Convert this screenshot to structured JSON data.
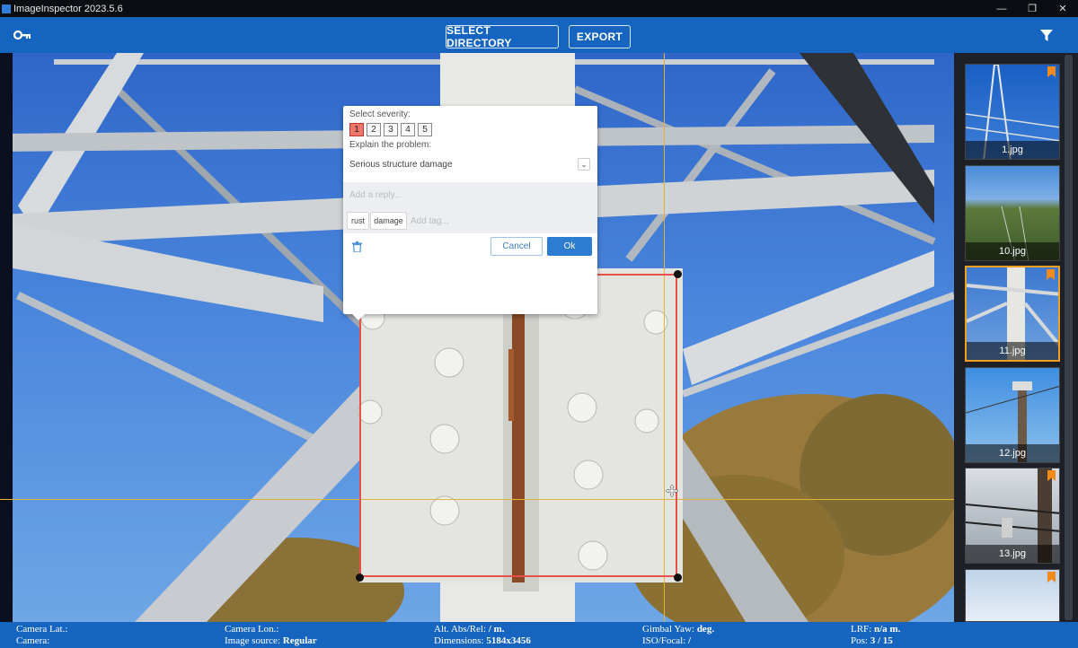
{
  "window": {
    "title": "ImageInspector 2023.5.6",
    "controls": [
      "—",
      "❐",
      "✕"
    ]
  },
  "toolbar": {
    "select_directory_label": "SELECT DIRECTORY",
    "export_label": "EXPORT",
    "left_icon": "key-icon",
    "right_icon": "filter-icon"
  },
  "annotation": {
    "severity_label": "Select severity:",
    "severity_options": [
      "1",
      "2",
      "3",
      "4",
      "5"
    ],
    "selected_severity": "1",
    "explain_label": "Explain the problem:",
    "problem_value": "Serious structure damage",
    "reply_placeholder": "Add a reply...",
    "tags": [
      "rust",
      "damage"
    ],
    "add_tag_placeholder": "Add tag...",
    "cancel_label": "Cancel",
    "ok_label": "Ok"
  },
  "thumbnails": [
    {
      "label": "1.jpg",
      "bookmarked": true,
      "selected": false
    },
    {
      "label": "10.jpg",
      "bookmarked": false,
      "selected": false
    },
    {
      "label": "11.jpg",
      "bookmarked": true,
      "selected": true
    },
    {
      "label": "12.jpg",
      "bookmarked": false,
      "selected": false
    },
    {
      "label": "13.jpg",
      "bookmarked": true,
      "selected": false
    },
    {
      "label": "",
      "bookmarked": true,
      "selected": false
    }
  ],
  "status": {
    "camera_lat_label": "Camera Lat.:",
    "camera_lat_value": "",
    "camera_label": "Camera:",
    "camera_value": "",
    "camera_lon_label": "Camera Lon.:",
    "camera_lon_value": "",
    "image_source_label": "Image source:",
    "image_source_value": "Regular",
    "alt_label": "Alt. Abs/Rel:",
    "alt_value": "/ m.",
    "dimensions_label": "Dimensions:",
    "dimensions_value": "5184x3456",
    "gimbal_yaw_label": "Gimbal Yaw:",
    "gimbal_yaw_value": "deg.",
    "iso_label": "ISO/Focal:",
    "iso_value": "/",
    "lrf_label": "LRF:",
    "lrf_value": "n/a m.",
    "pos_label": "Pos:",
    "pos_value": "3 / 15"
  },
  "colors": {
    "toolbar_blue": "#1565c0",
    "selection_red": "#e8504a",
    "crosshair_yellow": "#e0b430",
    "thumbnail_selected": "#f0a020",
    "severity_active": "#f0766a",
    "ok_button": "#2c7dd1"
  }
}
